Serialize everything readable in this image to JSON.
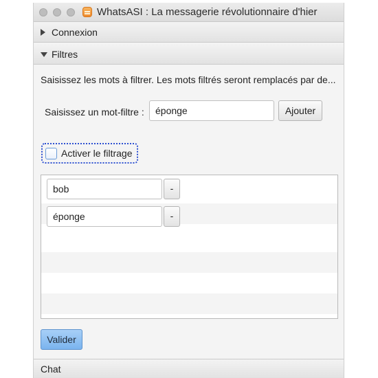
{
  "window": {
    "title": "WhatsASI : La messagerie révolutionnaire d'hier"
  },
  "panes": {
    "connexion": "Connexion",
    "filtres": "Filtres",
    "chat": "Chat"
  },
  "filters": {
    "description": "Saisissez les mots à filtrer. Les mots filtrés seront remplacés par de...",
    "input_label": "Saisissez un mot-filtre :",
    "input_value": "éponge",
    "add_button": "Ajouter",
    "checkbox_label": "Activer le filtrage",
    "checkbox_checked": false,
    "words": [
      {
        "value": "bob",
        "remove_label": "-"
      },
      {
        "value": "éponge",
        "remove_label": "-"
      }
    ],
    "submit_button": "Valider"
  },
  "icons": {
    "app": "whatsasi-app-icon",
    "expand": "chevron-right-icon",
    "collapse": "chevron-down-icon"
  }
}
